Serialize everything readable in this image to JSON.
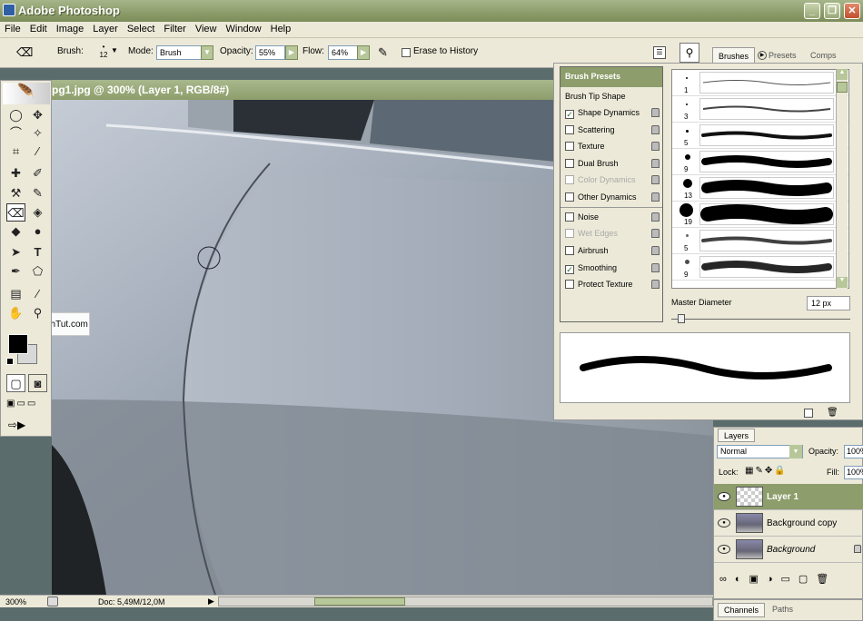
{
  "app": {
    "title": "Adobe Photoshop"
  },
  "window_buttons": {
    "minimize": "_",
    "restore": "❐",
    "close": "✕"
  },
  "menu": [
    "File",
    "Edit",
    "Image",
    "Layer",
    "Select",
    "Filter",
    "View",
    "Window",
    "Help"
  ],
  "options": {
    "brush_label": "Brush:",
    "brush_size": "12",
    "mode_label": "Mode:",
    "mode_value": "Brush",
    "opacity_label": "Opacity:",
    "opacity_value": "55%",
    "flow_label": "Flow:",
    "flow_value": "64%",
    "erase_history": "Erase to History"
  },
  "palette_tabs": {
    "brushes": "Brushes",
    "presets": "Presets",
    "comps": "Comps"
  },
  "document": {
    "title": "pg1.jpg @ 300% (Layer 1, RGB/8#)"
  },
  "watermark": "TechTut.com",
  "status": {
    "zoom": "300%",
    "doc": "Doc: 5,49M/12,0M"
  },
  "brushes": {
    "header": "Brush Presets",
    "tip_shape": "Brush Tip Shape",
    "items": [
      {
        "label": "Shape Dynamics",
        "checked": "✓"
      },
      {
        "label": "Scattering",
        "checked": ""
      },
      {
        "label": "Texture",
        "checked": ""
      },
      {
        "label": "Dual Brush",
        "checked": ""
      },
      {
        "label": "Color Dynamics",
        "checked": ""
      },
      {
        "label": "Other Dynamics",
        "checked": ""
      },
      {
        "label": "Noise",
        "checked": ""
      },
      {
        "label": "Wet Edges",
        "checked": ""
      },
      {
        "label": "Airbrush",
        "checked": ""
      },
      {
        "label": "Smoothing",
        "checked": "✓"
      },
      {
        "label": "Protect Texture",
        "checked": ""
      }
    ],
    "preset_sizes": [
      "1",
      "3",
      "5",
      "9",
      "13",
      "19",
      "5",
      "9"
    ],
    "master_diameter_label": "Master Diameter",
    "master_diameter_value": "12 px"
  },
  "layers": {
    "tab": "Layers",
    "blend": "Normal",
    "opacity_label": "Opacity:",
    "opacity_value": "100%",
    "lock_label": "Lock:",
    "fill_label": "Fill:",
    "fill_value": "100%",
    "rows": [
      {
        "name": "Layer 1"
      },
      {
        "name": "Background copy"
      },
      {
        "name": "Background"
      }
    ]
  },
  "bottom_tabs": {
    "channels": "Channels",
    "paths": "Paths"
  }
}
